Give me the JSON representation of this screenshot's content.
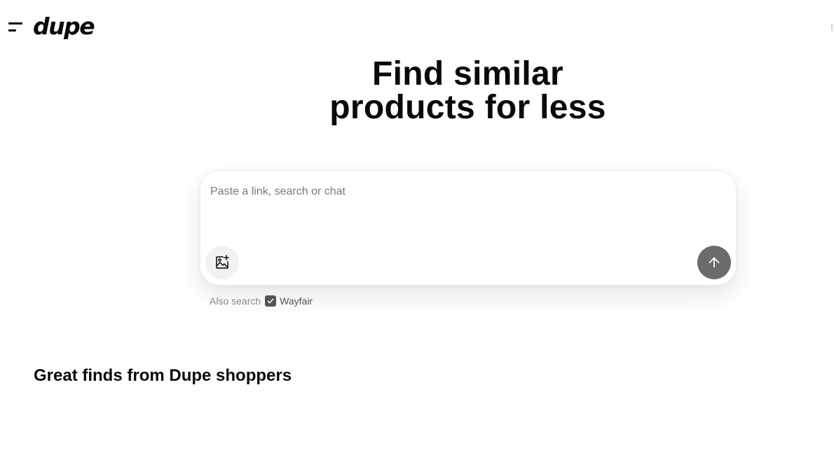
{
  "header": {
    "logo_text": "dupe",
    "menu_icon": "menu-icon"
  },
  "hero": {
    "title_line1": "Find similar",
    "title_line2": "products for less"
  },
  "search": {
    "placeholder": "Paste a link, search or chat",
    "value": "",
    "image_icon": "image-add-icon",
    "submit_icon": "arrow-up-icon"
  },
  "also_search": {
    "label": "Also search",
    "checked": true,
    "store": "Wayfair",
    "check_icon": "checkmark-icon"
  },
  "section": {
    "title": "Great finds from Dupe shoppers"
  },
  "colors": {
    "text": "#0a0a0a",
    "submit_button": "#6b6b6b",
    "checkbox": "#555555",
    "muted": "#8a8a8a"
  }
}
